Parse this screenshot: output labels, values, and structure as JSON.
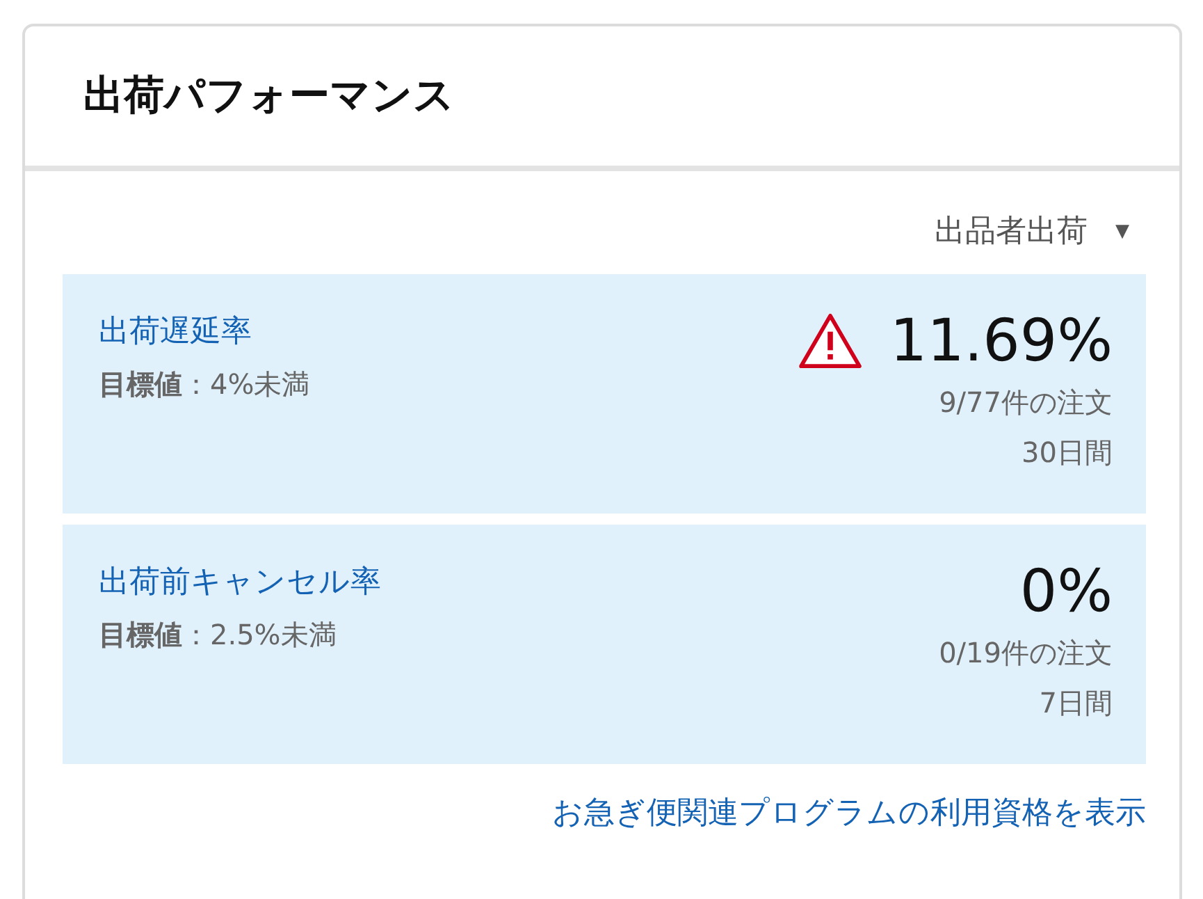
{
  "card": {
    "title": "出荷パフォーマンス"
  },
  "filter": {
    "label": "出品者出荷",
    "caret": "▼"
  },
  "metrics": [
    {
      "name": "出荷遅延率",
      "target": "**目標値**：4%未満",
      "warning": true,
      "value": "11.69%",
      "orders": "9/77件の注文",
      "period": "30日間"
    },
    {
      "name": "出荷前キャンセル率",
      "target": "**目標値**：2.5%未満",
      "warning": false,
      "value": "0%",
      "orders": "0/19件の注文",
      "period": "7日間"
    }
  ],
  "footer_link": "お急ぎ便関連プログラムの利用資格を表示"
}
